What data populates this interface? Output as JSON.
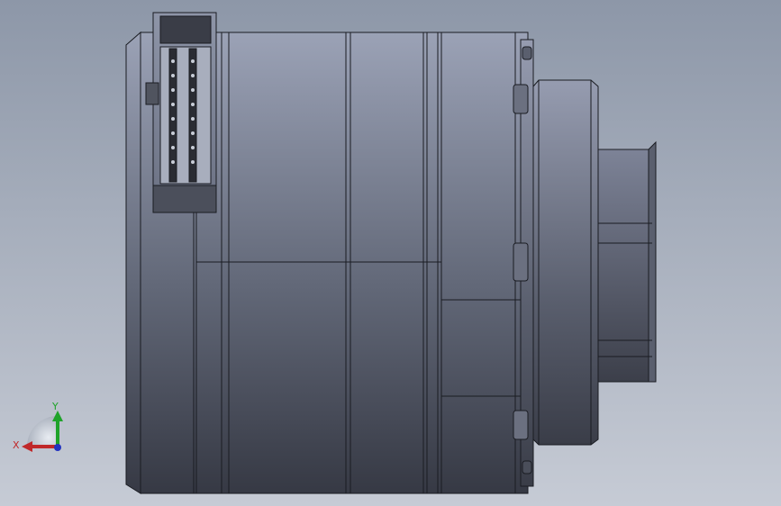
{
  "viewport": {
    "background_top": "#8d97a8",
    "background_bottom": "#c6cbd5"
  },
  "model": {
    "edge_color": "#1a1c22",
    "body_top": "#9aa0b4",
    "body_bottom": "#3a3d47"
  },
  "triad": {
    "x_label": "X",
    "y_label": "Y",
    "x_color": "#c0282a",
    "y_color": "#1fa32a",
    "z_color": "#2233c0"
  }
}
